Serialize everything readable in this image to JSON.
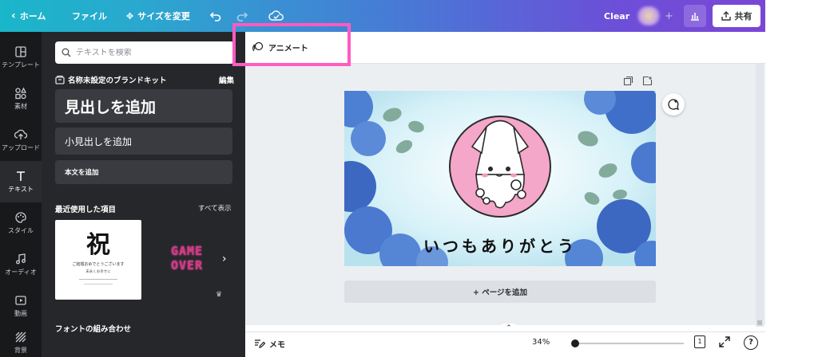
{
  "topbar": {
    "home_label": "ホーム",
    "file_label": "ファイル",
    "resize_label": "サイズを変更",
    "clear_label": "Clear",
    "share_label": "共有"
  },
  "rail": {
    "items": [
      {
        "label": "テンプレート",
        "icon": "template-icon"
      },
      {
        "label": "素材",
        "icon": "elements-icon"
      },
      {
        "label": "アップロード",
        "icon": "upload-icon"
      },
      {
        "label": "テキスト",
        "icon": "text-icon",
        "active": true
      },
      {
        "label": "スタイル",
        "icon": "palette-icon"
      },
      {
        "label": "オーディオ",
        "icon": "music-icon"
      },
      {
        "label": "動画",
        "icon": "video-icon"
      },
      {
        "label": "背景",
        "icon": "background-icon"
      }
    ]
  },
  "panel": {
    "search_placeholder": "テキストを検索",
    "brand_kit_label": "名称未設定のブランドキット",
    "edit_label": "編集",
    "heading_add": "見出しを追加",
    "subheading_add": "小見出しを追加",
    "body_add": "本文を追加",
    "recent_title": "最近使用した項目",
    "see_all": "すべて表示",
    "thumb1_big": "祝",
    "thumb1_line1": "ご結婚おめでとうございます",
    "thumb1_line2": "末永くお幸せに",
    "thumb2_line1": "GAME",
    "thumb2_line2": "OVER",
    "font_combo_title": "フォントの組み合わせ"
  },
  "context": {
    "animate_label": "アニメート"
  },
  "design": {
    "caption": "いつもありがとう",
    "colors": {
      "pink": "#f4a7c8",
      "blue": "#3f6fc9",
      "leaf": "#6f9b8a"
    }
  },
  "canvas": {
    "add_page_label": "+ ページを追加"
  },
  "bottom": {
    "notes_label": "メモ",
    "zoom": "34%",
    "zoom_level": 0.03,
    "page_number": "1",
    "help": "?"
  }
}
